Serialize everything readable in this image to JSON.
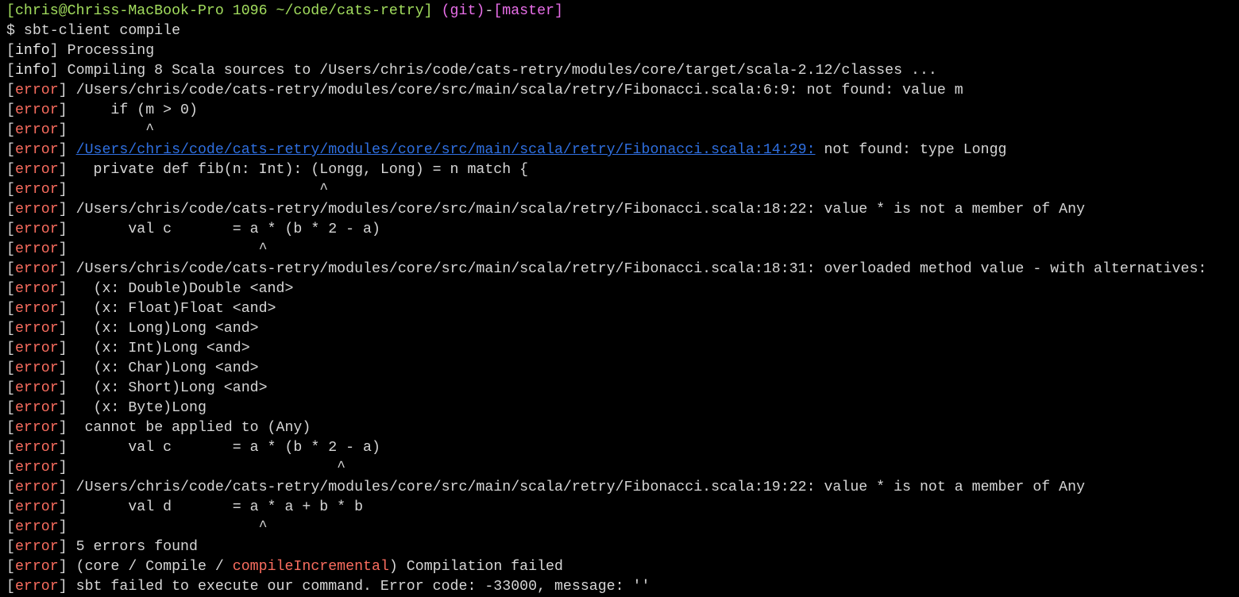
{
  "colors": {
    "prompt": "#a3de5e",
    "git": "#e86ee8",
    "error": "#fa6d5f",
    "link": "#2f6fe0",
    "text": "#d6d6d6",
    "background": "#000000"
  },
  "lines": [
    [
      [
        "g",
        "[chris@Chriss-MacBook-Pro 1096 ~/code/cats-retry]"
      ],
      [
        "t",
        " "
      ],
      [
        "m",
        "(git)"
      ],
      [
        "t",
        "-"
      ],
      [
        "m",
        "[master]"
      ]
    ],
    [
      [
        "t",
        "$ sbt-client compile"
      ]
    ],
    [
      [
        "t",
        "["
      ],
      [
        "w",
        "info"
      ],
      [
        "t",
        "] Processing"
      ]
    ],
    [
      [
        "t",
        "["
      ],
      [
        "w",
        "info"
      ],
      [
        "t",
        "] Compiling 8 Scala sources to /Users/chris/code/cats-retry/modules/core/target/scala-2.12/classes ..."
      ]
    ],
    [
      [
        "t",
        "["
      ],
      [
        "r",
        "error"
      ],
      [
        "t",
        "] /Users/chris/code/cats-retry/modules/core/src/main/scala/retry/Fibonacci.scala:6:9: not found: value m"
      ]
    ],
    [
      [
        "t",
        "["
      ],
      [
        "r",
        "error"
      ],
      [
        "t",
        "]     if (m > 0)"
      ]
    ],
    [
      [
        "t",
        "["
      ],
      [
        "r",
        "error"
      ],
      [
        "t",
        "]         ^"
      ]
    ],
    [
      [
        "t",
        "["
      ],
      [
        "r",
        "error"
      ],
      [
        "t",
        "] "
      ],
      [
        "link",
        "/Users/chris/code/cats-retry/modules/core/src/main/scala/retry/Fibonacci.scala:14:29:"
      ],
      [
        "t",
        " not found: type Longg"
      ]
    ],
    [
      [
        "t",
        "["
      ],
      [
        "r",
        "error"
      ],
      [
        "t",
        "]   private def fib(n: Int): (Longg, Long) = n match {"
      ]
    ],
    [
      [
        "t",
        "["
      ],
      [
        "r",
        "error"
      ],
      [
        "t",
        "]                             ^"
      ]
    ],
    [
      [
        "t",
        "["
      ],
      [
        "r",
        "error"
      ],
      [
        "t",
        "] /Users/chris/code/cats-retry/modules/core/src/main/scala/retry/Fibonacci.scala:18:22: value * is not a member of Any"
      ]
    ],
    [
      [
        "t",
        "["
      ],
      [
        "r",
        "error"
      ],
      [
        "t",
        "]       val c       = a * (b * 2 - a)"
      ]
    ],
    [
      [
        "t",
        "["
      ],
      [
        "r",
        "error"
      ],
      [
        "t",
        "]                      ^"
      ]
    ],
    [
      [
        "t",
        "["
      ],
      [
        "r",
        "error"
      ],
      [
        "t",
        "] /Users/chris/code/cats-retry/modules/core/src/main/scala/retry/Fibonacci.scala:18:31: overloaded method value - with alternatives:"
      ]
    ],
    [
      [
        "t",
        "["
      ],
      [
        "r",
        "error"
      ],
      [
        "t",
        "]   (x: Double)Double <and>"
      ]
    ],
    [
      [
        "t",
        "["
      ],
      [
        "r",
        "error"
      ],
      [
        "t",
        "]   (x: Float)Float <and>"
      ]
    ],
    [
      [
        "t",
        "["
      ],
      [
        "r",
        "error"
      ],
      [
        "t",
        "]   (x: Long)Long <and>"
      ]
    ],
    [
      [
        "t",
        "["
      ],
      [
        "r",
        "error"
      ],
      [
        "t",
        "]   (x: Int)Long <and>"
      ]
    ],
    [
      [
        "t",
        "["
      ],
      [
        "r",
        "error"
      ],
      [
        "t",
        "]   (x: Char)Long <and>"
      ]
    ],
    [
      [
        "t",
        "["
      ],
      [
        "r",
        "error"
      ],
      [
        "t",
        "]   (x: Short)Long <and>"
      ]
    ],
    [
      [
        "t",
        "["
      ],
      [
        "r",
        "error"
      ],
      [
        "t",
        "]   (x: Byte)Long"
      ]
    ],
    [
      [
        "t",
        "["
      ],
      [
        "r",
        "error"
      ],
      [
        "t",
        "]  cannot be applied to (Any)"
      ]
    ],
    [
      [
        "t",
        "["
      ],
      [
        "r",
        "error"
      ],
      [
        "t",
        "]       val c       = a * (b * 2 - a)"
      ]
    ],
    [
      [
        "t",
        "["
      ],
      [
        "r",
        "error"
      ],
      [
        "t",
        "]                               ^"
      ]
    ],
    [
      [
        "t",
        "["
      ],
      [
        "r",
        "error"
      ],
      [
        "t",
        "] /Users/chris/code/cats-retry/modules/core/src/main/scala/retry/Fibonacci.scala:19:22: value * is not a member of Any"
      ]
    ],
    [
      [
        "t",
        "["
      ],
      [
        "r",
        "error"
      ],
      [
        "t",
        "]       val d       = a * a + b * b"
      ]
    ],
    [
      [
        "t",
        "["
      ],
      [
        "r",
        "error"
      ],
      [
        "t",
        "]                      ^"
      ]
    ],
    [
      [
        "t",
        "["
      ],
      [
        "r",
        "error"
      ],
      [
        "t",
        "] 5 errors found"
      ]
    ],
    [
      [
        "t",
        "["
      ],
      [
        "r",
        "error"
      ],
      [
        "t",
        "] (core / Compile / "
      ],
      [
        "r",
        "compileIncremental"
      ],
      [
        "t",
        ") Compilation failed"
      ]
    ],
    [
      [
        "t",
        "["
      ],
      [
        "r",
        "error"
      ],
      [
        "t",
        "] sbt failed to execute our command. Error code: -33000, message: ''"
      ]
    ]
  ]
}
